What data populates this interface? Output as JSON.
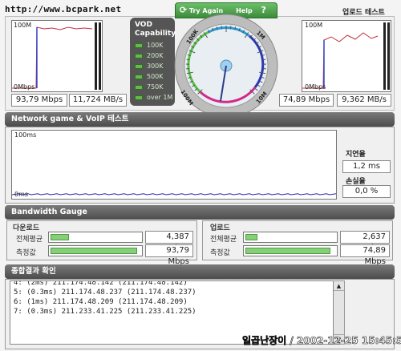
{
  "watermark": "http://www.bcpark.net",
  "download_graph": {
    "top_label": "100M",
    "bottom_label": "0Mbps",
    "mbps": "93,79 Mbps",
    "mbs": "11,724 MB/s"
  },
  "upload_graph": {
    "title": "업로드 테스트",
    "top_label": "100M",
    "bottom_label": "0Mbps",
    "mbps": "74,89 Mbps",
    "mbs": "9,362 MB/s"
  },
  "vod": {
    "title_line1": "VOD",
    "title_line2": "Capability",
    "levels": [
      "100K",
      "200K",
      "300K",
      "500K",
      "750K",
      "over 1M"
    ]
  },
  "gauge": {
    "try_again": "Try Again",
    "help": "Help",
    "help_icon": "?",
    "ticks": [
      "100K",
      "1M",
      "10M",
      "100M"
    ],
    "needle_value_mbps": 93.79
  },
  "network_section": {
    "title": "Network game & VoIP 테스트",
    "top_label": "100ms",
    "bottom_label": "0ms",
    "latency_label": "지연율",
    "latency_value": "1,2 ms",
    "loss_label": "손실율",
    "loss_value": "0,0 %"
  },
  "bandwidth_section": {
    "title": "Bandwidth Gauge",
    "download": {
      "title": "다운로드",
      "avg_label": "전체평균",
      "avg_value": "4,387 Mbps",
      "avg_fill": 0.21,
      "meas_label": "측정값",
      "meas_value": "93,79 Mbps",
      "meas_fill": 0.98
    },
    "upload": {
      "title": "업로드",
      "avg_label": "전체평균",
      "avg_value": "2,637 Mbps",
      "avg_fill": 0.14,
      "meas_label": "측정값",
      "meas_value": "74,89 Mbps",
      "meas_fill": 0.96
    }
  },
  "summary_section": {
    "title": "종합결과 확인",
    "lines": [
      "4: (2ms) 211.174.48.142 (211.174.48.142)",
      "5: (0.3ms) 211.174.48.237 (211.174.48.237)",
      "6: (1ms) 211.174.48.209 (211.174.48.209)",
      "7: (0.3ms) 211.233.41.225 (211.233.41.225)"
    ]
  },
  "footer_stamp": "일곱난장이 / 2002-12-25 15:45:53",
  "colors": {
    "graph_line": "#c03040",
    "download_marker": "#3348c8",
    "latency_line": "#2a2ab0",
    "fill_green": "#86cf78",
    "vod_green": "#68b74a",
    "header_dark": "#555555"
  }
}
